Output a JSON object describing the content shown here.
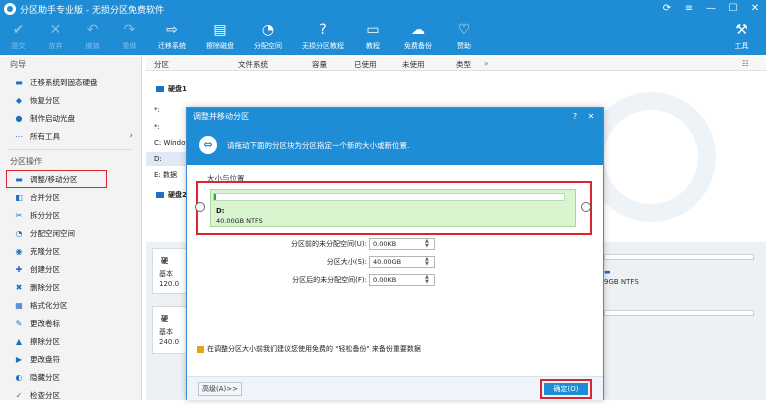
{
  "app": {
    "title": "分区助手专业版 - 无损分区免费软件",
    "window_buttons": [
      "⟳",
      "≡",
      "—",
      "☐",
      "✕"
    ]
  },
  "toolbar": {
    "buttons": [
      {
        "label": "提交",
        "icon": "✔"
      },
      {
        "label": "放弃",
        "icon": "✕"
      },
      {
        "label": "撤销",
        "icon": "↶"
      },
      {
        "label": "重做",
        "icon": "↷"
      },
      {
        "label": "迁移系统",
        "icon": "⇨"
      },
      {
        "label": "擦除磁盘",
        "icon": "▤"
      },
      {
        "label": "分配空间",
        "icon": "◔"
      },
      {
        "label": "无损分区教程",
        "icon": "?"
      },
      {
        "label": "教程",
        "icon": "▭"
      },
      {
        "label": "免费备份",
        "icon": "☁"
      },
      {
        "label": "赞助",
        "icon": "♡"
      }
    ],
    "tools_label": "工具",
    "tools_icon": "⚒"
  },
  "sidebar": {
    "wizard_title": "向导",
    "wizard_items": [
      {
        "label": "迁移系统到固态硬盘",
        "icon": "▬"
      },
      {
        "label": "恢复分区",
        "icon": "◆"
      },
      {
        "label": "制作启动光盘",
        "icon": "●"
      },
      {
        "label": "所有工具",
        "icon": "⋯"
      }
    ],
    "ops_title": "分区操作",
    "ops_items": [
      {
        "label": "调整/移动分区",
        "icon": "▬"
      },
      {
        "label": "合并分区",
        "icon": "◧"
      },
      {
        "label": "拆分分区",
        "icon": "✂"
      },
      {
        "label": "分配空闲空间",
        "icon": "◔"
      },
      {
        "label": "克隆分区",
        "icon": "◉"
      },
      {
        "label": "创建分区",
        "icon": "✚"
      },
      {
        "label": "删除分区",
        "icon": "✖"
      },
      {
        "label": "格式化分区",
        "icon": "▦"
      },
      {
        "label": "更改卷标",
        "icon": "✎"
      },
      {
        "label": "擦除分区",
        "icon": "▲"
      },
      {
        "label": "更改盘符",
        "icon": "▶"
      },
      {
        "label": "隐藏分区",
        "icon": "◐"
      },
      {
        "label": "检查分区",
        "icon": "✓"
      }
    ]
  },
  "columns": [
    "分区",
    "文件系统",
    "容量",
    "已使用",
    "未使用",
    "类型"
  ],
  "partition_list": {
    "disk1": "硬盘1",
    "rows": [
      "*:",
      "*:",
      "C: Windows",
      "D:",
      "E: 数据"
    ],
    "disk2": "硬盘2"
  },
  "lower_cards": [
    {
      "name": "硬",
      "type": "基本",
      "size": "120.0"
    },
    {
      "name": "硬",
      "type": "基本",
      "size": "240.0"
    }
  ],
  "right_fragment": "9GB NTFS",
  "dialog": {
    "title": "调整并移动分区",
    "banner_text": "请拖动下面的分区块为分区指定一个新的大小或新位置.",
    "size_position_label": "大小与位置",
    "partition_name": "D:",
    "partition_info": "40.00GB NTFS",
    "fields": [
      {
        "label": "分区前的未分配空间(U):",
        "value": "0.00KB"
      },
      {
        "label": "分区大小(S):",
        "value": "40.00GB"
      },
      {
        "label": "分区后的未分配空间(F):",
        "value": "0.00KB"
      }
    ],
    "warning": "在调整分区大小前我们建议您使用免费的 \"轻松备份\" 来备份重要数据",
    "advanced_button": "高级(A)>>",
    "ok_button": "确定(O)"
  }
}
